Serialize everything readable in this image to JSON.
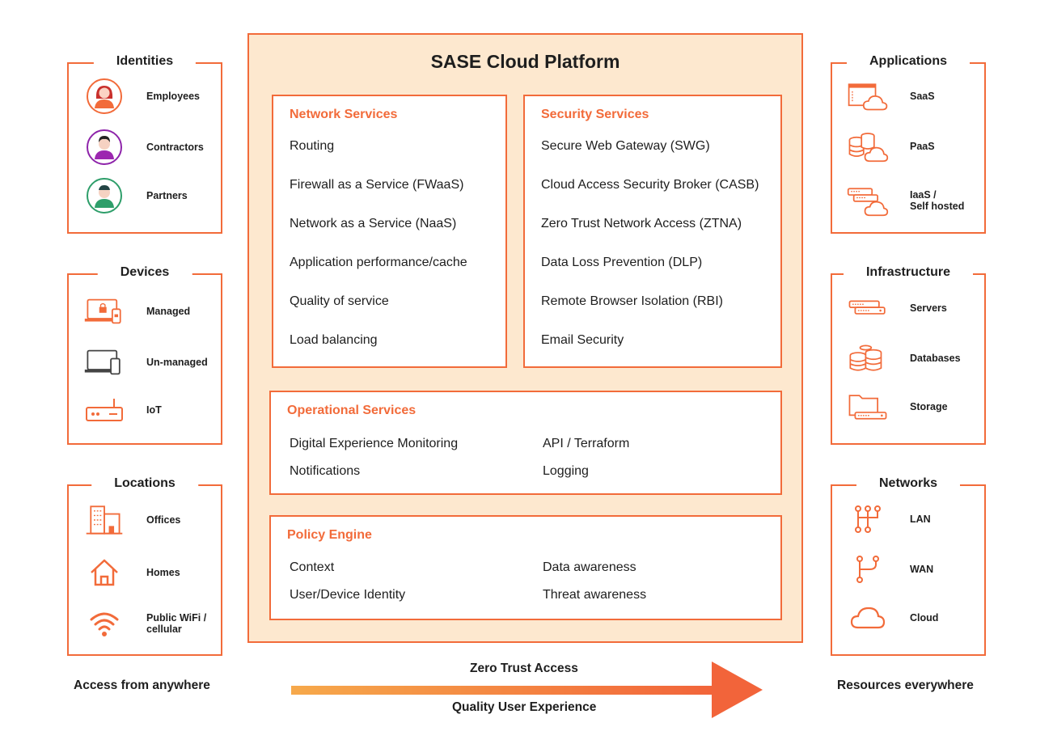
{
  "colors": {
    "accent": "#f26b3a",
    "platform_bg": "#fde8cf",
    "text": "#1e1e1e"
  },
  "left": {
    "identities": {
      "title": "Identities",
      "items": [
        {
          "label": "Employees",
          "icon": "employee-avatar-icon"
        },
        {
          "label": "Contractors",
          "icon": "contractor-avatar-icon"
        },
        {
          "label": "Partners",
          "icon": "partner-avatar-icon"
        }
      ]
    },
    "devices": {
      "title": "Devices",
      "items": [
        {
          "label": "Managed",
          "icon": "managed-laptop-icon"
        },
        {
          "label": "Un-managed",
          "icon": "unmanaged-laptop-icon"
        },
        {
          "label": "IoT",
          "icon": "iot-device-icon"
        }
      ]
    },
    "locations": {
      "title": "Locations",
      "items": [
        {
          "label": "Offices",
          "icon": "office-building-icon"
        },
        {
          "label": "Homes",
          "icon": "home-icon"
        },
        {
          "label": "Public WiFi /",
          "label2": "cellular",
          "icon": "wifi-icon"
        }
      ]
    },
    "footer": "Access from anywhere"
  },
  "platform": {
    "title": "SASE Cloud Platform",
    "network": {
      "title": "Network Services",
      "items": [
        "Routing",
        "Firewall as a Service (FWaaS)",
        "Network as a Service (NaaS)",
        "Application performance/cache",
        "Quality of service",
        "Load balancing"
      ]
    },
    "security": {
      "title": "Security Services",
      "items": [
        "Secure Web Gateway (SWG)",
        "Cloud Access Security Broker (CASB)",
        "Zero Trust Network Access (ZTNA)",
        "Data Loss Prevention (DLP)",
        "Remote Browser Isolation (RBI)",
        "Email Security"
      ]
    },
    "operational": {
      "title": "Operational Services",
      "items": [
        "Digital Experience Monitoring",
        "API / Terraform",
        "Notifications",
        "Logging"
      ]
    },
    "policy": {
      "title": "Policy Engine",
      "items": [
        "Context",
        "Data awareness",
        "User/Device Identity",
        "Threat awareness"
      ]
    }
  },
  "right": {
    "applications": {
      "title": "Applications",
      "items": [
        {
          "label": "SaaS",
          "icon": "saas-cloud-icon"
        },
        {
          "label": "PaaS",
          "icon": "paas-database-cloud-icon"
        },
        {
          "label": "IaaS /",
          "label2": "Self hosted",
          "icon": "iaas-server-cloud-icon"
        }
      ]
    },
    "infrastructure": {
      "title": "Infrastructure",
      "items": [
        {
          "label": "Servers",
          "icon": "servers-icon"
        },
        {
          "label": "Databases",
          "icon": "databases-icon"
        },
        {
          "label": "Storage",
          "icon": "storage-folder-icon"
        }
      ]
    },
    "networks": {
      "title": "Networks",
      "items": [
        {
          "label": "LAN",
          "icon": "lan-icon"
        },
        {
          "label": "WAN",
          "icon": "wan-icon"
        },
        {
          "label": "Cloud",
          "icon": "cloud-icon"
        }
      ]
    },
    "footer": "Resources everywhere"
  },
  "arrow": {
    "top_label": "Zero Trust Access",
    "bottom_label": "Quality User Experience"
  }
}
